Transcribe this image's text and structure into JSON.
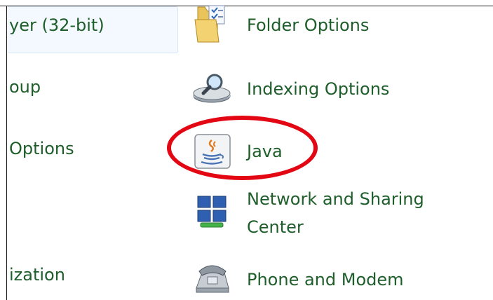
{
  "left_column": {
    "items": [
      {
        "label": "yer (32-bit)"
      },
      {
        "label": "oup"
      },
      {
        "label": "Options"
      },
      {
        "label": "ization"
      }
    ]
  },
  "right_column": {
    "items": [
      {
        "label": "Folder Options",
        "icon": "folder-options-icon"
      },
      {
        "label": "Indexing Options",
        "icon": "indexing-options-icon"
      },
      {
        "label": "Java",
        "icon": "java-icon"
      },
      {
        "label_line1": "Network and Sharing",
        "label_line2": "Center",
        "icon": "network-sharing-icon"
      },
      {
        "label": "Phone and Modem",
        "icon": "phone-modem-icon"
      }
    ]
  },
  "highlight": {
    "color": "#e30613",
    "target": "Java"
  },
  "colors": {
    "link_text": "#1e5e2a",
    "selection_bg": "#f4f9ff"
  }
}
